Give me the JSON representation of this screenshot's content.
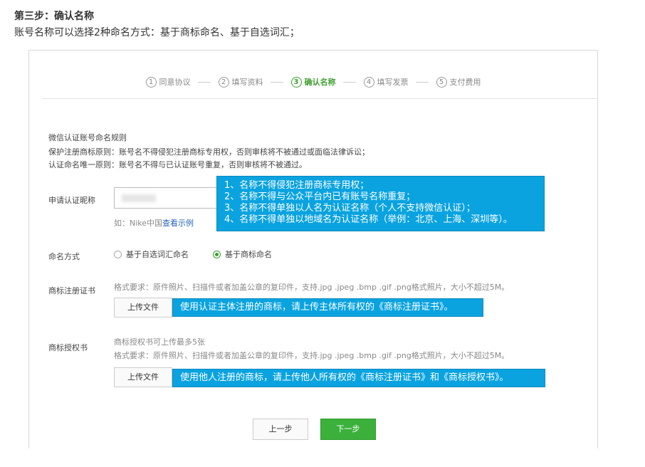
{
  "header": {
    "title": "第三步：确认名称",
    "description": "账号名称可以选择2种命名方式：基于商标命名、基于自选词汇；"
  },
  "steps": [
    {
      "num": "1",
      "label": "同意协议"
    },
    {
      "num": "2",
      "label": "填写资料"
    },
    {
      "num": "3",
      "label": "确认名称",
      "active": true
    },
    {
      "num": "4",
      "label": "填写发票"
    },
    {
      "num": "5",
      "label": "支付费用"
    }
  ],
  "rules": {
    "title": "微信认证账号命名规则",
    "line1": "保护注册商标原则：账号名不得侵犯注册商标专用权，否则审核将不被通过或面临法律诉讼；",
    "line2": "认证命名唯一原则：账号名不得与已认证账号重复，否则审核将不被通过。"
  },
  "nickname": {
    "label": "申请认证昵称",
    "hint_prefix": "如：Nike中国",
    "hint_link": "查看示例"
  },
  "callouts": {
    "nickname": [
      "1、名称不得侵犯注册商标专用权；",
      "2、名称不得与公众平台内已有账号名称重复；",
      "3、名称不得单独以人名为认证名称（个人不支持微信认证）；",
      "4、名称不得单独以地域名为认证名称（举例：北京、上海、深圳等）。"
    ],
    "cert": "使用认证主体注册的商标，请上传主体所有权的《商标注册证书》。",
    "auth": "使用他人注册的商标，请上传他人所有权的《商标注册证书》和《商标授权书》。"
  },
  "naming": {
    "label": "命名方式",
    "option_custom": "基于自选词汇命名",
    "option_trademark": "基于商标命名",
    "selected": "基于商标命名"
  },
  "trademark_cert": {
    "label": "商标注册证书",
    "format": "格式要求：原件照片、扫描件或者加盖公章的复印件，支持.jpg .jpeg .bmp .gif .png格式照片，大小不超过5M。",
    "upload": "上传文件"
  },
  "trademark_auth": {
    "label": "商标授权书",
    "limit": "商标授权书可上传最多5张",
    "format": "格式要求：原件照片、扫描件或者加盖公章的复印件，支持.jpg .jpeg .bmp .gif .png格式照片，大小不超过5M。",
    "upload": "上传文件"
  },
  "buttons": {
    "prev": "上一步",
    "next": "下一步"
  },
  "colors": {
    "accent_green": "#3bb13b",
    "callout_blue": "#0aa3e0",
    "link_blue": "#2a63b7"
  }
}
